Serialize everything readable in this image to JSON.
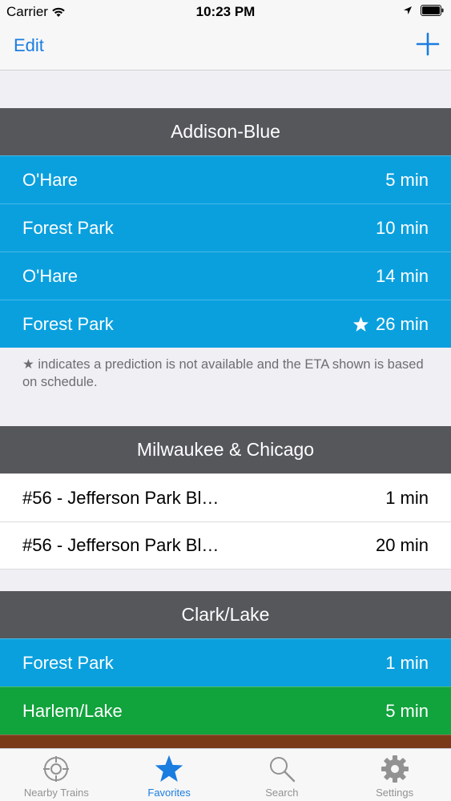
{
  "status_bar": {
    "carrier": "Carrier",
    "time": "10:23 PM"
  },
  "nav": {
    "edit_label": "Edit",
    "add_icon": "plus-icon"
  },
  "sections": [
    {
      "title": "Addison-Blue",
      "rows": [
        {
          "destination": "O'Hare",
          "eta": "5 min",
          "scheduled": false
        },
        {
          "destination": "Forest Park",
          "eta": "10 min",
          "scheduled": false
        },
        {
          "destination": "O'Hare",
          "eta": "14 min",
          "scheduled": false
        },
        {
          "destination": "Forest Park",
          "eta": "26 min",
          "scheduled": true
        }
      ],
      "footnote": "★ indicates a prediction is not available and the ETA shown is based on schedule."
    },
    {
      "title": "Milwaukee & Chicago",
      "rows": [
        {
          "destination": "#56 - Jefferson Park Bl…",
          "eta": "1 min"
        },
        {
          "destination": "#56 - Jefferson Park Bl…",
          "eta": "20 min"
        }
      ]
    },
    {
      "title": "Clark/Lake",
      "rows": [
        {
          "destination": "Forest Park",
          "eta": "1 min"
        },
        {
          "destination": "Harlem/Lake",
          "eta": "5 min"
        }
      ]
    }
  ],
  "tabs": [
    {
      "label": "Nearby Trains",
      "icon": "crosshair-icon",
      "active": false
    },
    {
      "label": "Favorites",
      "icon": "star-icon",
      "active": true
    },
    {
      "label": "Search",
      "icon": "search-icon",
      "active": false
    },
    {
      "label": "Settings",
      "icon": "gear-icon",
      "active": false
    }
  ],
  "colors": {
    "blue_line": "#0aa0de",
    "green_line": "#11a33c",
    "brown_line": "#7a3a18",
    "accent": "#1a7de0",
    "header": "#55575b"
  }
}
